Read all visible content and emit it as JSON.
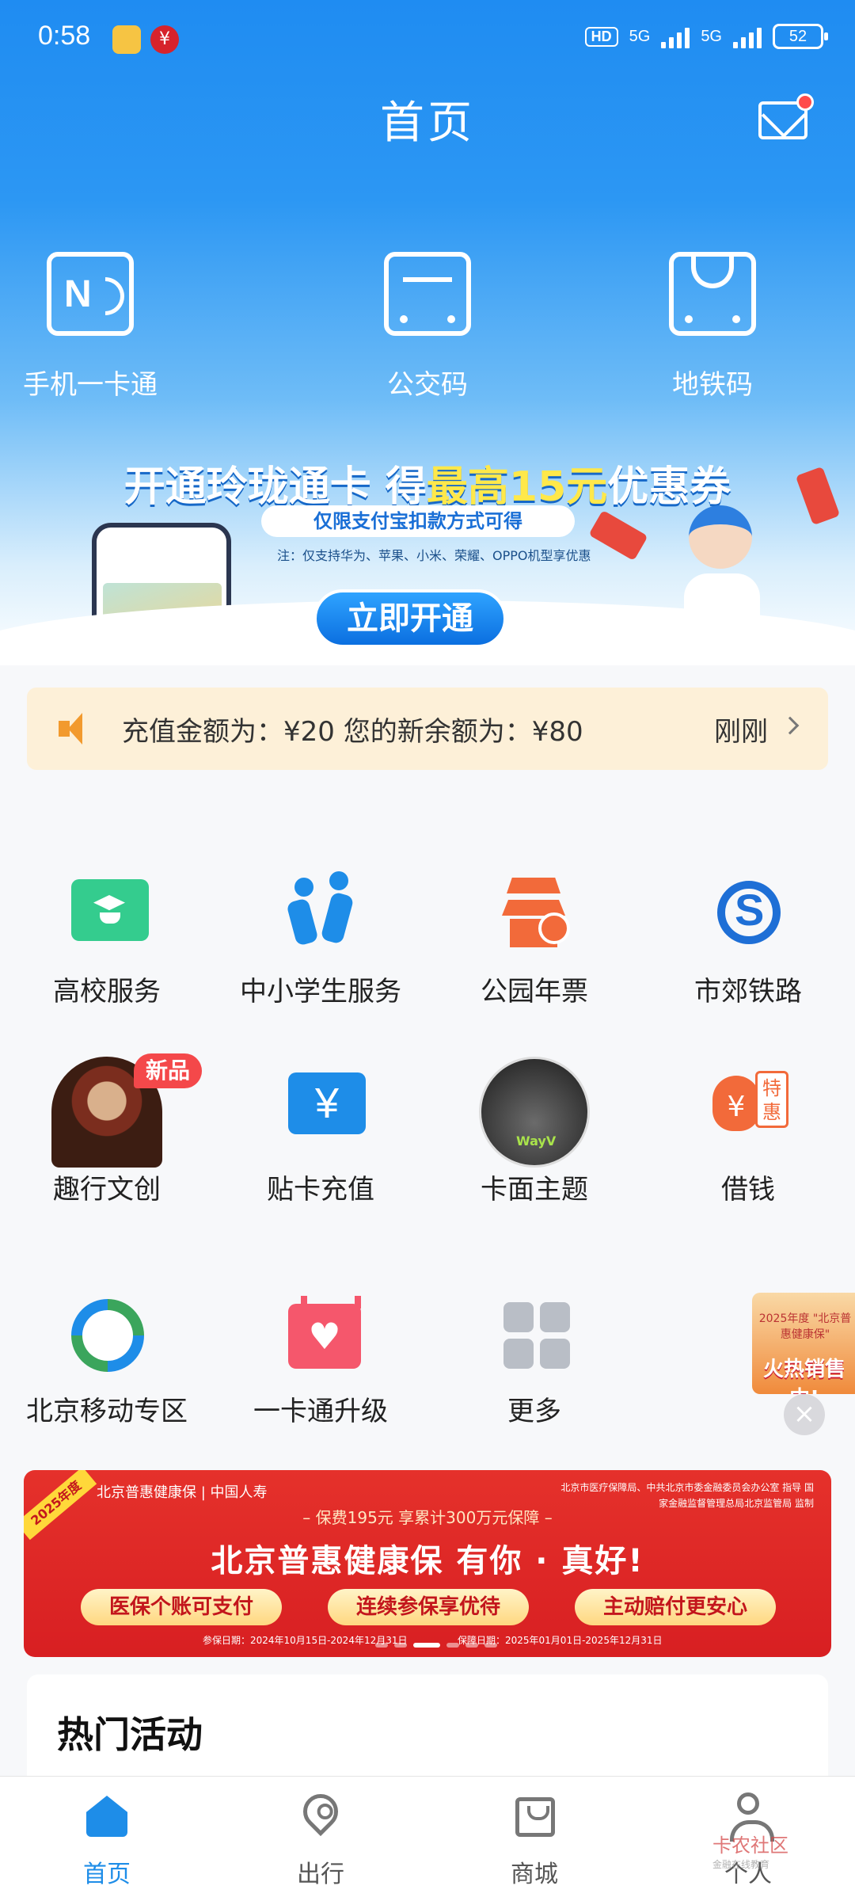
{
  "status_bar": {
    "time": "0:58",
    "network1": "5G",
    "network2": "5G",
    "battery": "52",
    "hd": "HD"
  },
  "header": {
    "title": "首页"
  },
  "top_shortcuts": [
    {
      "label": "手机一卡通",
      "icon": "nfc-card-icon"
    },
    {
      "label": "公交码",
      "icon": "bus-icon"
    },
    {
      "label": "地铁码",
      "icon": "subway-icon"
    }
  ],
  "banner": {
    "title_prefix": "开通玲珑通卡 得",
    "title_highlight": "最高15元",
    "title_suffix": "优惠券",
    "subtitle": "仅限支付宝扣款方式可得",
    "note": "注：仅支持华为、苹果、小米、荣耀、OPPO机型享优惠",
    "button": "立即开通"
  },
  "notice": {
    "text": "充值金额为：¥20 您的新余额为：¥80",
    "time": "刚刚"
  },
  "services": [
    {
      "label": "高校服务",
      "icon": "graduation-cap-icon"
    },
    {
      "label": "中小学生服务",
      "icon": "students-icon"
    },
    {
      "label": "公园年票",
      "icon": "park-pavilion-icon"
    },
    {
      "label": "市郊铁路",
      "icon": "suburban-rail-icon"
    },
    {
      "label": "趣行文创",
      "icon": "portrait-icon",
      "badge": "新品"
    },
    {
      "label": "贴卡充值",
      "icon": "yen-icon",
      "glyph": "¥"
    },
    {
      "label": "卡面主题",
      "icon": "card-theme-icon",
      "logo": "WayV"
    },
    {
      "label": "借钱",
      "icon": "loan-icon",
      "glyph": "¥",
      "tag": "特惠"
    },
    {
      "label": "北京移动专区",
      "icon": "china-mobile-icon"
    },
    {
      "label": "一卡通升级",
      "icon": "calendar-heart-icon"
    },
    {
      "label": "更多",
      "icon": "more-grid-icon"
    }
  ],
  "float_ad": {
    "text": "2025年度 \"北京普惠健康保\"",
    "hot": "火热销售中!",
    "close": "×"
  },
  "health_banner": {
    "tag": "2025年度",
    "brand": "北京普惠健康保 | 中国人寿",
    "gov": "北京市医疗保障局、中共北京市委金融委员会办公室 指导 国家金融监督管理总局北京监管局 监制",
    "subtitle": "– 保费195元 享累计300万元保障 –",
    "title": "北京普惠健康保 有你 · 真好!",
    "pills": [
      "医保个账可支付",
      "连续参保享优待",
      "主动赔付更安心"
    ],
    "date_enroll": "参保日期：2024年10月15日-2024年12月31日",
    "date_cover": "保障日期：2025年01月01日-2025年12月31日"
  },
  "hot_section": {
    "title": "热门活动"
  },
  "bottom_nav": [
    {
      "label": "首页",
      "icon": "home-icon",
      "active": true
    },
    {
      "label": "出行",
      "icon": "location-pin-icon"
    },
    {
      "label": "商城",
      "icon": "shopping-bag-icon"
    },
    {
      "label": "个人",
      "icon": "person-icon"
    }
  ],
  "watermark": {
    "text": "卡农社区",
    "sub": "金融在线教育"
  },
  "colors": {
    "primary": "#1e8de8",
    "notice_bg": "#fdf0d8",
    "health_red": "#e5312b",
    "accent_orange": "#f26a3a",
    "green": "#34cc8e"
  }
}
